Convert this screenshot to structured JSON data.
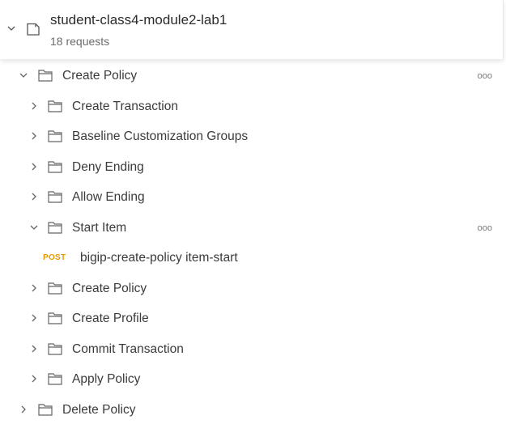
{
  "collection": {
    "name": "student-class4-module2-lab1",
    "count": "18 requests",
    "icons": {
      "toggle": "chevron-down-icon",
      "type": "collection-icon"
    }
  },
  "tree": {
    "create_policy_folder": {
      "label": "Create Policy",
      "more": "ooo"
    },
    "children": [
      {
        "label": "Create Transaction"
      },
      {
        "label": "Baseline Customization Groups"
      },
      {
        "label": "Deny Ending"
      },
      {
        "label": "Allow Ending"
      },
      {
        "label": "Start Item",
        "more": "ooo"
      },
      {
        "label": "Create Policy"
      },
      {
        "label": "Create Profile"
      },
      {
        "label": "Commit Transaction"
      },
      {
        "label": "Apply Policy"
      }
    ],
    "request": {
      "method": "POST",
      "label": "bigip-create-policy item-start",
      "method_color": "#e69a00"
    },
    "delete_policy_folder": {
      "label": "Delete Policy"
    }
  }
}
